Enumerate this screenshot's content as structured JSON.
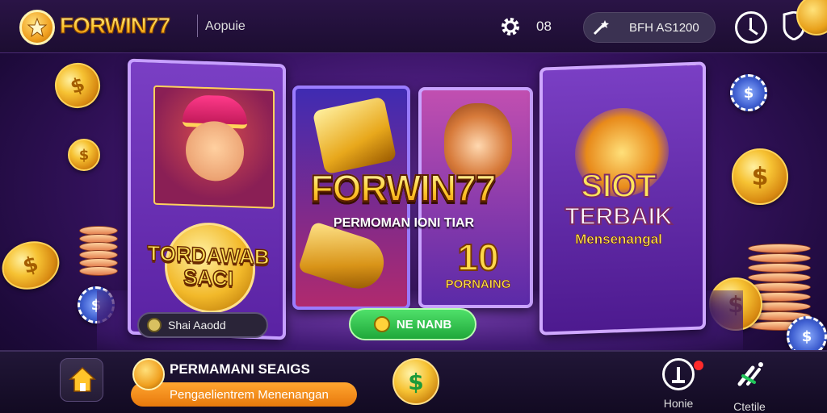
{
  "header": {
    "brand": "FORWIN77",
    "tab_label": "Aopuie",
    "settings_count": "08",
    "balance_label": "BFH AS1200"
  },
  "cards": [
    {
      "title_line1": "TORDAWAB",
      "title_line2": "SACI"
    },
    {
      "hero_title": "FORWIN77",
      "hero_subtitle": "PERMOMAN IONI TIAR"
    },
    {
      "number": "10",
      "label": "PORNAING"
    },
    {
      "title_line1": "SIOT",
      "title_line2": "TERBAIK",
      "title_line3": "Mensenangal"
    }
  ],
  "actions": {
    "left_pill": "Shai Aaodd",
    "play_button": "NE NANB"
  },
  "bottom": {
    "promo_title": "PERMAMANI SEAIGS",
    "promo_subtitle": "Pengaelientrem Menenangan",
    "coin_symbol": "$",
    "nav_home_label": "Honie",
    "nav_profile_label": "Ctetile"
  },
  "colors": {
    "accent_gold": "#ffc42a",
    "play_green": "#1fa83a",
    "promo_orange": "#e8780c",
    "background_purple": "#3a1466"
  }
}
